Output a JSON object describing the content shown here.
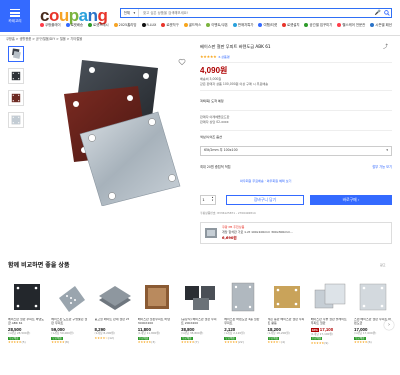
{
  "header": {
    "menu_label": "카테고리",
    "logo": [
      "c",
      "o",
      "u",
      "p",
      "a",
      "n",
      "g"
    ],
    "search_category": "전체",
    "search_placeholder": "찾고 싶은 상품을 검색해보세요!",
    "quick_links": [
      {
        "label": "쿠팡플레이",
        "color": "#ff3d4a"
      },
      {
        "label": "로켓배송",
        "color": "#346aff"
      },
      {
        "label": "로켓프레시",
        "color": "#2d9b2a"
      },
      {
        "label": "2025홈리빙",
        "color": "#f6a425"
      },
      {
        "label": "R.LUX",
        "color": "#111111"
      },
      {
        "label": "로켓직구",
        "color": "#e8352b"
      },
      {
        "label": "골드박스",
        "color": "#f7a51b"
      },
      {
        "label": "이벤트/쿠폰",
        "color": "#7bb33e"
      },
      {
        "label": "판매자특가",
        "color": "#2aa1dc"
      },
      {
        "label": "여행/티켓",
        "color": "#346aff"
      },
      {
        "label": "로켓설치",
        "color": "#e8352b"
      },
      {
        "label": "공간별 집꾸미기",
        "color": "#2d9b2a"
      },
      {
        "label": "헬스케어 전문관",
        "color": "#ff3d4a"
      },
      {
        "label": "시즌별 패션",
        "color": "#2a73c8"
      }
    ]
  },
  "breadcrumb": "쿠팡홈 > 생활용품 > 공구/철물/DIY > 철물 > 기타철물",
  "product": {
    "title": "베이스판 철판 무피트 바텐도금 ABK 61",
    "rating_stars": "★★★★★",
    "review_count": "6 상품평",
    "price": "4,090원",
    "shipping_fee": "배송비 3,000원",
    "shipping_note": "같은 판매자 상품 100,000원 이상 구매 시 무료배송",
    "arrival": "3/6(목) 도착 예정",
    "seller_line1": "판매자 이레베플로드판",
    "seller_line2": "판매자 상담 02-xxxx",
    "option_label": "색상/사이즈 옵션",
    "option_selected": "65t/2mm 무 100x100",
    "coupon_text": "최대 20원 중립적 적립",
    "coupon_link": "할부 가능 보기",
    "membership": "와우회원 무료배송 · 와우회원 혜택 보기",
    "quantity": "1",
    "cart_label": "장바구니 담기",
    "buy_label": "바로구매 ›",
    "code_label": "쿠팡상품번호: 8336125871 - 2706492814",
    "ad_line1": "쿠팡 PB 추천상품",
    "ad_line2": "개당 함석판 가로 1.2t 100x100mm 300x300mm...",
    "ad_price": "6,690원"
  },
  "recommend": {
    "title": "함께 비교하면 좋을 상품",
    "ad_label": "광고",
    "items": [
      {
        "title": "베이스판 철판 무피트 바텐도금 ABK 61",
        "price": "28,500",
        "unit": "(1개당 28,500원)",
        "badge": "무료배송",
        "stars": "★★★★★",
        "reviews": "(5)",
        "img": "dark"
      },
      {
        "title": "베이스판 도트판 구멍뚫린 철판 무피트",
        "price": "59,000",
        "unit": "(1개당 59,000원)",
        "badge": "무료배송",
        "stars": "★★★★★",
        "reviews": "(8)",
        "img": "perf"
      },
      {
        "title": "중고철 메이트 판재 철판 2t",
        "price": "8,290",
        "unit": "(1개당 8,290원)",
        "badge": "",
        "stars": "★★★★☆",
        "reviews": "(12)",
        "img": "stack"
      },
      {
        "title": "베이스판 철판무피트 바텐 3000X200",
        "price": "11,800",
        "unit": "(1개당 11,800원)",
        "badge": "무료배송",
        "stars": "★★★★★",
        "reviews": "(3)",
        "img": "rust"
      },
      {
        "title": "(공장직) 베이스판 철판 무피트 200X200",
        "price": "38,800",
        "unit": "(1개당 38,800원)",
        "badge": "무료배송",
        "stars": "★★★★★",
        "reviews": "(7)",
        "img": "multi"
      },
      {
        "title": "베이스판 바텐도금 4홀 철판 무피트",
        "price": "2,120",
        "unit": "(1개당 2,120원)",
        "badge": "무료배송",
        "stars": "★★★★★",
        "reviews": "(22)",
        "img": "gray"
      },
      {
        "title": "적은 동판 베이스판 철판 무피트 황동",
        "price": "18,200",
        "unit": "(1개당 18,200원)",
        "badge": "무료배송",
        "stars": "★★★★☆",
        "reviews": "(4)",
        "img": "brass"
      },
      {
        "title": "베이스판 주물 철판 플레이트 무피트 철판",
        "price": "17,100",
        "unit": "(1개당 17,100원)",
        "badge": "무료배송",
        "stars": "★★★★★",
        "reviews": "(9)",
        "img": "stack2",
        "discount": "18%"
      },
      {
        "title": "스텐 베이스판 철판 무피트 바텐도금",
        "price": "17,000",
        "unit": "(1개당 17,000원)",
        "badge": "무료배송",
        "stars": "★★★★★",
        "reviews": "(6)",
        "img": "silver"
      }
    ]
  }
}
